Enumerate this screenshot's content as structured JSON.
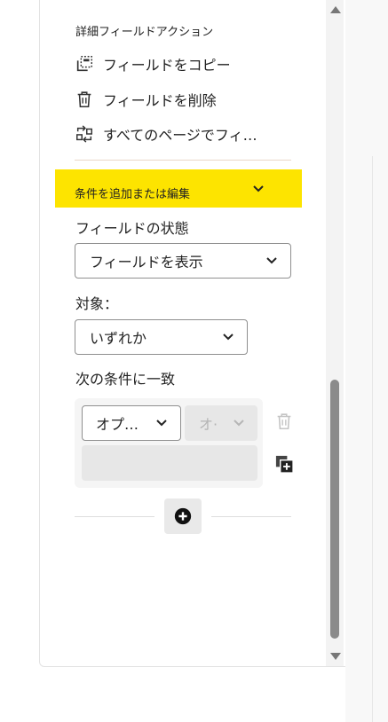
{
  "field_actions": {
    "title": "詳細フィールドアクション",
    "items": [
      {
        "label": "フィールドをコピー",
        "icon": "copy-field-icon"
      },
      {
        "label": "フィールドを削除",
        "icon": "trash-icon"
      },
      {
        "label": "すべてのページでフィ…",
        "icon": "pages-sync-icon"
      }
    ]
  },
  "conditions": {
    "header_label": "条件を追加または編集",
    "header_color": "#fde400",
    "field_state_label": "フィールドの状態",
    "field_state_value": "フィールドを表示",
    "target_label": "対象：",
    "target_value": "いずれか",
    "match_label": "次の条件に一致",
    "operand_value": "オプ…",
    "operator_value": "オ·"
  }
}
